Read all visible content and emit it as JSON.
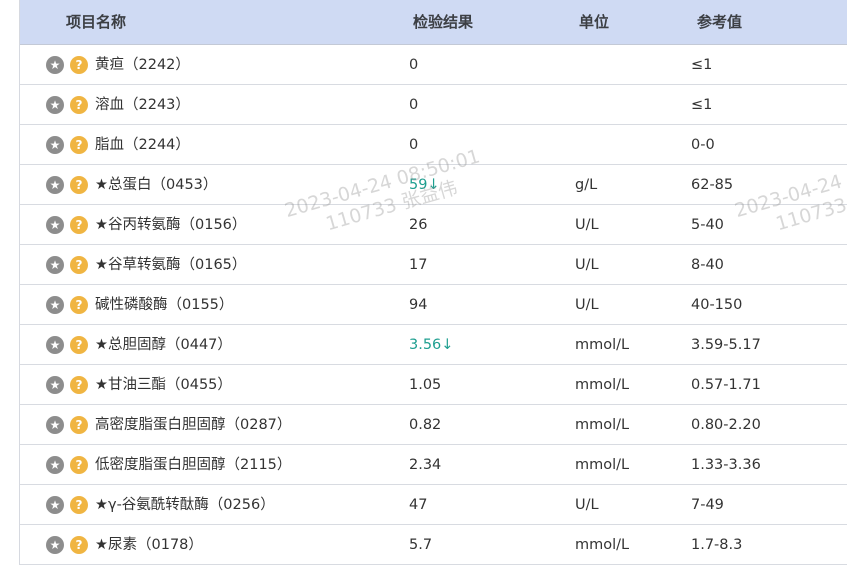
{
  "header": {
    "name": "项目名称",
    "result": "检验结果",
    "unit": "单位",
    "ref": "参考值"
  },
  "icons": {
    "star": "★",
    "help": "?",
    "down_arrow": "↓"
  },
  "rows": [
    {
      "name": "黄疸（2242）",
      "result": "0",
      "unit": "",
      "ref": "≤1"
    },
    {
      "name": "溶血（2243）",
      "result": "0",
      "unit": "",
      "ref": "≤1"
    },
    {
      "name": "脂血（2244）",
      "result": "0",
      "unit": "",
      "ref": "0-0"
    },
    {
      "name": "★总蛋白（0453）",
      "result": "59",
      "flag": "↓",
      "unit": "g/L",
      "ref": "62-85"
    },
    {
      "name": "★谷丙转氨酶（0156）",
      "result": "26",
      "unit": "U/L",
      "ref": "5-40"
    },
    {
      "name": "★谷草转氨酶（0165）",
      "result": "17",
      "unit": "U/L",
      "ref": "8-40"
    },
    {
      "name": "碱性磷酸酶（0155）",
      "result": "94",
      "unit": "U/L",
      "ref": "40-150"
    },
    {
      "name": "★总胆固醇（0447）",
      "result": "3.56",
      "flag": "↓",
      "unit": "mmol/L",
      "ref": "3.59-5.17"
    },
    {
      "name": "★甘油三酯（0455）",
      "result": "1.05",
      "unit": "mmol/L",
      "ref": "0.57-1.71"
    },
    {
      "name": "高密度脂蛋白胆固醇（0287）",
      "result": "0.82",
      "unit": "mmol/L",
      "ref": "0.80-2.20"
    },
    {
      "name": "低密度脂蛋白胆固醇（2115）",
      "result": "2.34",
      "unit": "mmol/L",
      "ref": "1.33-3.36"
    },
    {
      "name": "★γ-谷氨酰转酞酶（0256）",
      "result": "47",
      "unit": "U/L",
      "ref": "7-49"
    },
    {
      "name": "★尿素（0178）",
      "result": "5.7",
      "unit": "mmol/L",
      "ref": "1.7-8.3"
    }
  ],
  "watermark": {
    "timestamp": "2023-04-24 08:50:01",
    "user": "110733 张益伟",
    "timestamp_partial": "2023-04-24 0",
    "user_partial": "110733 张"
  }
}
